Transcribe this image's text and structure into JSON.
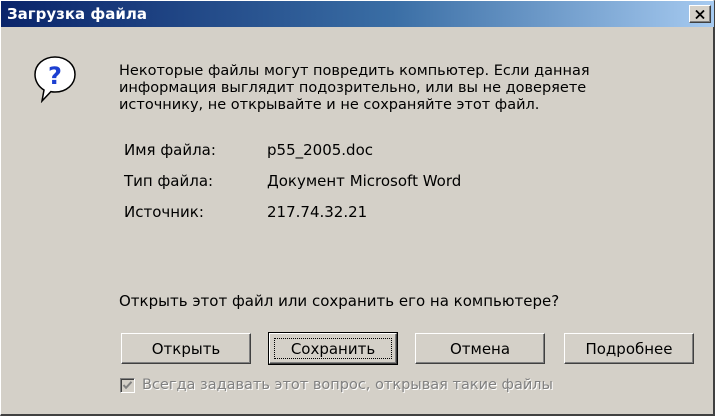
{
  "dialog": {
    "title": "Загрузка файла",
    "close_symbol": "×",
    "message": "Некоторые файлы могут повредить компьютер. Если данная\nинформация выглядит подозрительно, или вы не доверяете\nисточнику, не открывайте и не сохраняйте этот файл.",
    "icon": "question-icon",
    "file_info": [
      {
        "label": "Имя файла:",
        "value": "p55_2005.doc"
      },
      {
        "label": "Тип файла:",
        "value": "Документ Microsoft Word"
      },
      {
        "label": "Источник:",
        "value": "217.74.32.21"
      }
    ],
    "question": "Открыть этот файл или сохранить его на компьютере?",
    "buttons": {
      "open": "Открыть",
      "save": "Сохранить",
      "cancel": "Отмена",
      "more": "Подробнее"
    },
    "checkbox": {
      "label": "Всегда задавать этот вопрос, открывая такие файлы",
      "checked": true,
      "disabled": true
    }
  },
  "colors": {
    "window_bg": "#d4d0c8",
    "title_start": "#0a246a",
    "title_end": "#a6caf0",
    "disabled_text": "#808080"
  }
}
